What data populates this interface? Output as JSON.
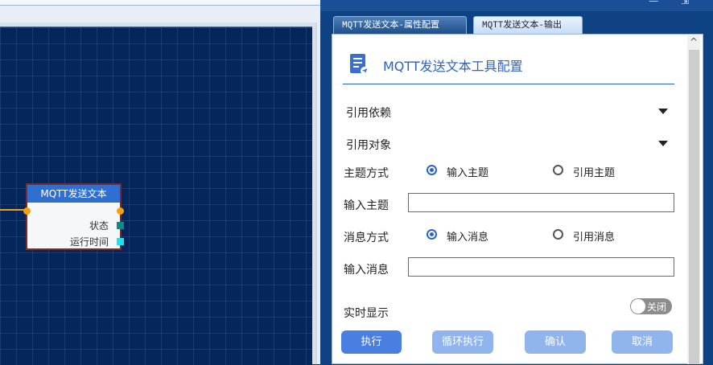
{
  "canvas": {
    "node": {
      "title": "MQTT发送文本",
      "outputs": [
        {
          "label": "状态",
          "color": "#0e8a8f"
        },
        {
          "label": "运行时间",
          "color": "#19e3f0"
        }
      ],
      "port_color": "#f5a00a",
      "wire_color": "#f0a020"
    }
  },
  "tabs": [
    {
      "label": "MQTT发送文本-属性配置",
      "active": true
    },
    {
      "label": "MQTT发送文本-输出",
      "active": false
    }
  ],
  "panel": {
    "header_icon": "document-send-icon",
    "title": "MQTT发送文本工具配置",
    "fields": {
      "ref_dependency": {
        "label": "引用依赖",
        "value": ""
      },
      "ref_object": {
        "label": "引用对象",
        "value": ""
      },
      "topic_mode": {
        "label": "主题方式",
        "options": [
          "输入主题",
          "引用主题"
        ],
        "selected": "输入主题"
      },
      "topic_input": {
        "label": "输入主题",
        "value": ""
      },
      "message_mode": {
        "label": "消息方式",
        "options": [
          "输入消息",
          "引用消息"
        ],
        "selected": "输入消息"
      },
      "message_input": {
        "label": "输入消息",
        "value": ""
      },
      "realtime": {
        "label": "实时显示",
        "toggle_text": "关闭",
        "on": false
      }
    },
    "buttons": {
      "execute": "执行",
      "loop_execute": "循环执行",
      "confirm": "确认",
      "cancel": "取消"
    }
  },
  "colors": {
    "accent": "#2b63c5",
    "button_primary": "#4a7ee0",
    "button_secondary": "#8fb4ee",
    "canvas_bg": "#05265a"
  }
}
